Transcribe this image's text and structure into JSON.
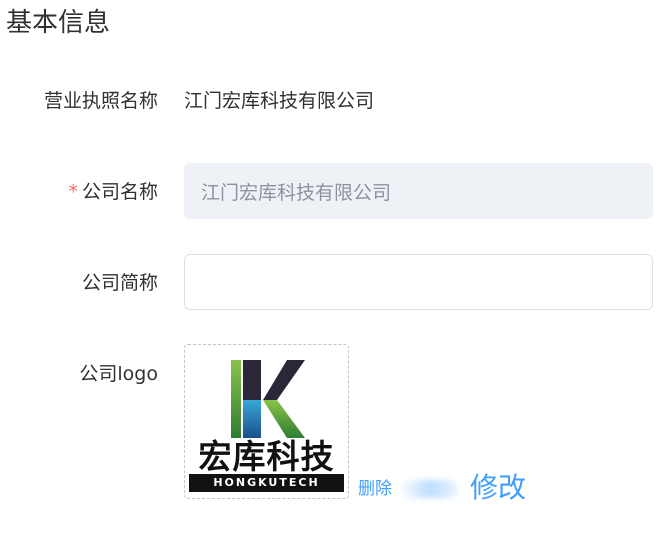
{
  "section": {
    "title": "基本信息"
  },
  "business_license": {
    "label": "营业执照名称",
    "value": "江门宏库科技有限公司"
  },
  "company_name": {
    "required_mark": "*",
    "label": "公司名称",
    "value": "江门宏库科技有限公司",
    "disabled": true
  },
  "company_short_name": {
    "label": "公司简称",
    "value": "",
    "placeholder": ""
  },
  "company_logo": {
    "label": "公司logo",
    "logo_text_cn": "宏库科技",
    "logo_text_en": "HONGKUTECH",
    "delete_label": "删除",
    "edit_label": "修改"
  },
  "colors": {
    "link": "#409eff",
    "required": "#f56c6c",
    "disabled_bg": "#eef1f6",
    "border": "#dcdfe6"
  }
}
